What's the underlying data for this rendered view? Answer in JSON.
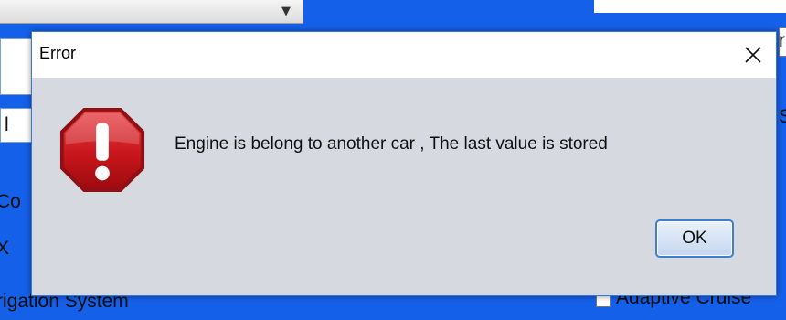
{
  "dialog": {
    "title": "Error",
    "message": "Engine is belong to another car , The last value is stored",
    "ok_label": "OK",
    "icon": "error-stop-icon",
    "close_icon": "close-icon"
  },
  "background": {
    "combo_arrow": "▼",
    "left_labels": [
      "l",
      "Co",
      "X",
      "rigation System"
    ],
    "right_labels": [
      "r",
      "Sid",
      "Adaptive Cruise"
    ]
  },
  "colors": {
    "window_background": "#1560e8",
    "dialog_background": "#d6d9e0",
    "error_red": "#c8161b",
    "button_border": "#3c7fcf"
  }
}
